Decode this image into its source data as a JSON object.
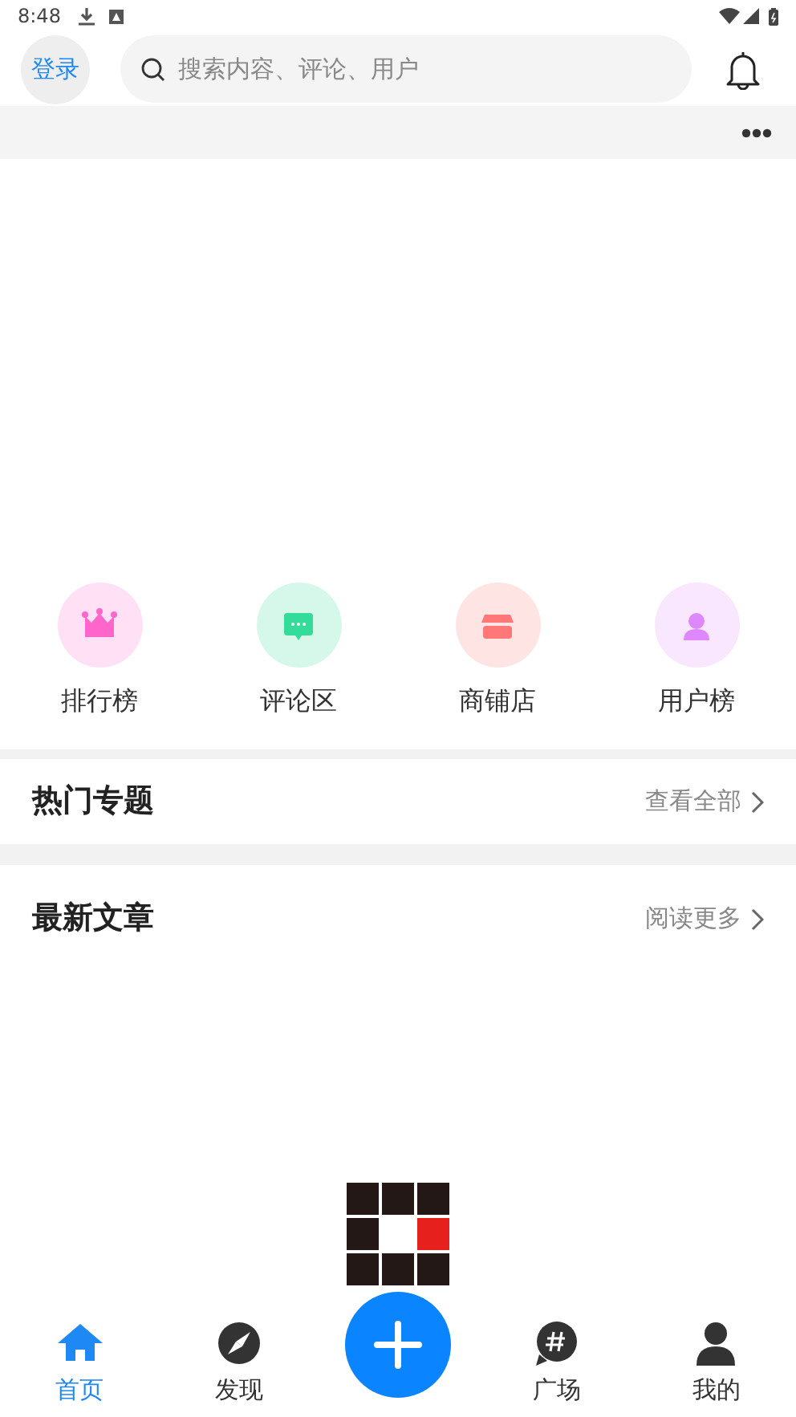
{
  "status_bar": {
    "time": "8:48"
  },
  "header": {
    "login": "登录",
    "search": {
      "placeholder": "搜索内容、评论、用户"
    }
  },
  "shortcuts": [
    {
      "kind": "crown",
      "label": "排行榜",
      "color": "#ff66cc"
    },
    {
      "kind": "comment",
      "label": "评论区",
      "color": "#33dd99"
    },
    {
      "kind": "shop",
      "label": "商铺店",
      "color": "#ff7777"
    },
    {
      "kind": "user",
      "label": "用户榜",
      "color": "#dd88ff"
    }
  ],
  "sections": [
    {
      "title": "热门专题",
      "link": "查看全部"
    },
    {
      "title": "最新文章",
      "link": "阅读更多"
    }
  ],
  "bottom_nav": [
    {
      "kind": "home",
      "label": "首页",
      "selected": true
    },
    {
      "kind": "compass",
      "label": "发现",
      "selected": false
    },
    {
      "kind": "add"
    },
    {
      "kind": "hash",
      "label": "广场",
      "selected": false
    },
    {
      "kind": "person",
      "label": "我的",
      "selected": false
    }
  ]
}
